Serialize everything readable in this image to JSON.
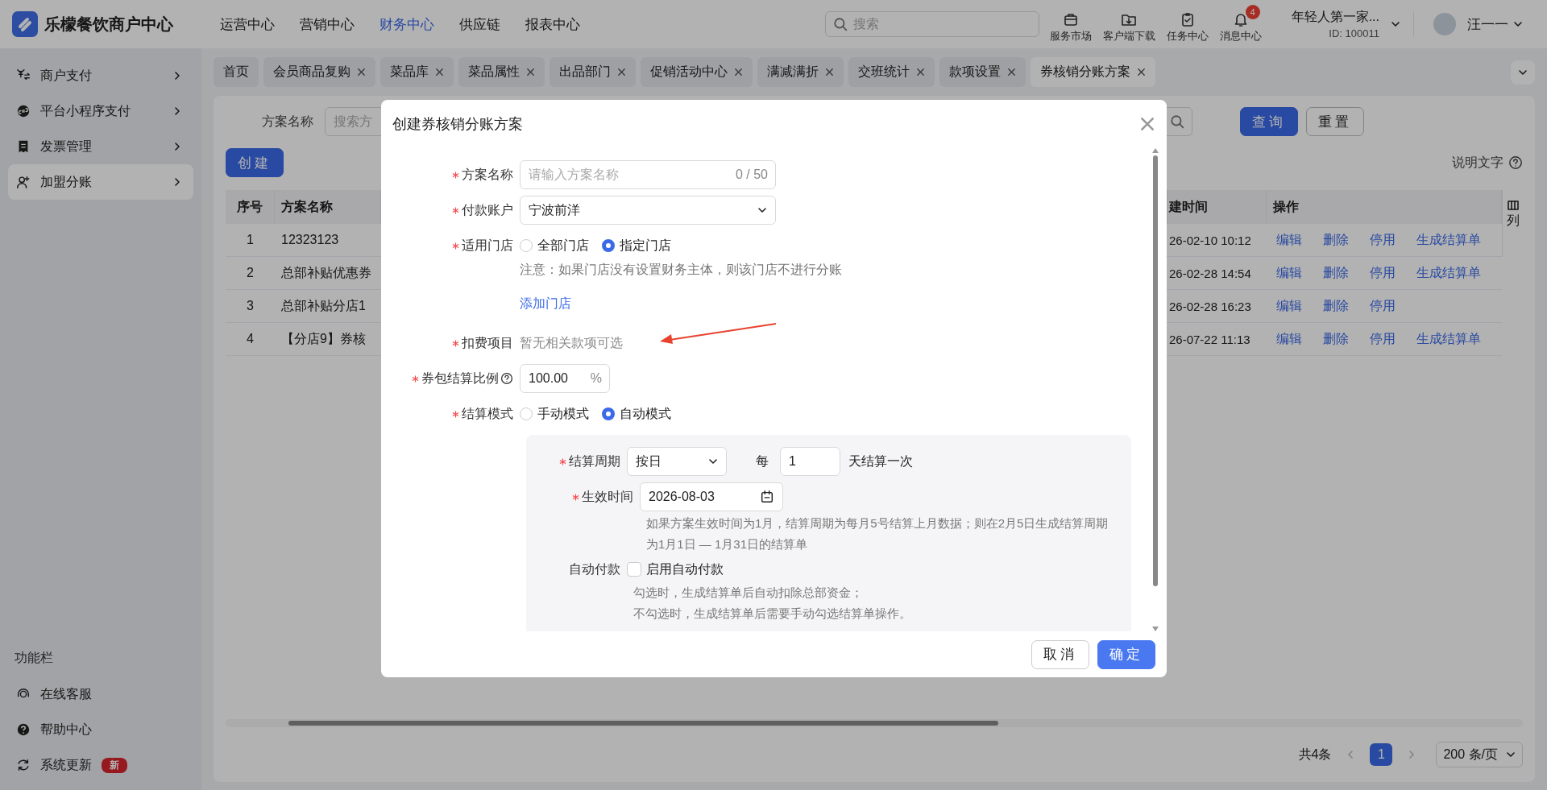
{
  "app": {
    "title": "乐檬餐饮商户中心"
  },
  "nav": [
    {
      "label": "运营中心",
      "selected": false
    },
    {
      "label": "营销中心",
      "selected": false
    },
    {
      "label": "财务中心",
      "selected": true
    },
    {
      "label": "供应链",
      "selected": false
    },
    {
      "label": "报表中心",
      "selected": false
    }
  ],
  "search": {
    "placeholder": "搜索"
  },
  "tools": [
    {
      "label": "服务市场"
    },
    {
      "label": "客户端下载"
    },
    {
      "label": "任务中心"
    },
    {
      "label": "消息中心",
      "badge": "4"
    }
  ],
  "account": {
    "store": "年轻人第一家...",
    "id": "ID: 100011"
  },
  "user": {
    "name": "汪一一"
  },
  "sidebar": {
    "items": [
      {
        "label": "商户支付",
        "selected": false
      },
      {
        "label": "平台小程序支付",
        "selected": false
      },
      {
        "label": "发票管理",
        "selected": false
      },
      {
        "label": "加盟分账",
        "selected": true
      }
    ],
    "section_title": "功能栏",
    "tools": [
      {
        "label": "在线客服"
      },
      {
        "label": "帮助中心"
      },
      {
        "label": "系统更新",
        "badge": "新"
      }
    ]
  },
  "tabs": [
    {
      "label": "首页",
      "closable": false,
      "selected": false
    },
    {
      "label": "会员商品复购",
      "closable": true,
      "selected": false
    },
    {
      "label": "菜品库",
      "closable": true,
      "selected": false
    },
    {
      "label": "菜品属性",
      "closable": true,
      "selected": false
    },
    {
      "label": "出品部门",
      "closable": true,
      "selected": false
    },
    {
      "label": "促销活动中心",
      "closable": true,
      "selected": false
    },
    {
      "label": "满减满折",
      "closable": true,
      "selected": false
    },
    {
      "label": "交班统计",
      "closable": true,
      "selected": false
    },
    {
      "label": "款项设置",
      "closable": true,
      "selected": false
    },
    {
      "label": "券核销分账方案",
      "closable": true,
      "selected": true
    }
  ],
  "filter": {
    "label": "方案名称",
    "placeholder": "搜索方",
    "buttons": [
      {
        "label": "查询",
        "kind": "primary"
      },
      {
        "label": "重置",
        "kind": "secondary"
      }
    ]
  },
  "create_button": "创建",
  "help_text": "说明文字",
  "table": {
    "columns": [
      "序号",
      "方案名称",
      "建时间",
      "操作"
    ],
    "column_settings": "列",
    "rows": [
      {
        "index": "1",
        "name": "12323123",
        "time": "26-02-10 10:12",
        "actions": [
          "编辑",
          "删除",
          "停用",
          "生成结算单"
        ]
      },
      {
        "index": "2",
        "name": "总部补贴优惠券",
        "time": "26-02-28 14:54",
        "actions": [
          "编辑",
          "删除",
          "停用",
          "生成结算单"
        ]
      },
      {
        "index": "3",
        "name": "总部补贴分店1",
        "time": "26-02-28 16:23",
        "actions": [
          "编辑",
          "删除",
          "停用"
        ]
      },
      {
        "index": "4",
        "name": "【分店9】券核",
        "time": "26-07-22 11:13",
        "actions": [
          "编辑",
          "删除",
          "停用",
          "生成结算单"
        ]
      }
    ]
  },
  "pagination": {
    "total": "共4条",
    "pages": [
      {
        "label": "1",
        "selected": true
      }
    ],
    "page_size": "200 条/页"
  },
  "dialog": {
    "title": "创建券核销分账方案",
    "fields": [
      {
        "kind": "text",
        "label": "方案名称",
        "required": true,
        "placeholder": "请输入方案名称",
        "counter": "0 / 50"
      },
      {
        "kind": "select",
        "label": "付款账户",
        "required": true,
        "value": "宁波前洋"
      },
      {
        "kind": "radio",
        "label": "适用门店",
        "required": true,
        "options": [
          {
            "label": "全部门店",
            "selected": false
          },
          {
            "label": "指定门店",
            "selected": true
          }
        ],
        "note": "注意：如果门店没有设置财务主体，则该门店不进行分账",
        "link": "添加门店"
      },
      {
        "kind": "static",
        "label": "扣费项目",
        "required": true,
        "value": "暂无相关款项可选"
      },
      {
        "kind": "percent",
        "label": "券包结算比例",
        "required": true,
        "help": true,
        "value": "100.00",
        "suffix": "%"
      },
      {
        "kind": "radio",
        "label": "结算模式",
        "required": true,
        "options": [
          {
            "label": "手动模式",
            "selected": false
          },
          {
            "label": "自动模式",
            "selected": true
          }
        ]
      }
    ],
    "panel": {
      "period": {
        "label": "结算周期",
        "required": true,
        "value": "按日",
        "prefix": "每",
        "count": "1",
        "suffix": "天结算一次"
      },
      "effective": {
        "label": "生效时间",
        "required": true,
        "value": "2026-08-03",
        "hint": "如果方案生效时间为1月，结算周期为每月5号结算上月数据；则在2月5日生成结算周期为1月1日 — 1月31日的结算单"
      },
      "auto_pay": {
        "label": "自动付款",
        "required": false,
        "option": "启用自动付款",
        "checked": false,
        "hints": [
          "勾选时，生成结算单后自动扣除总部资金；",
          "不勾选时，生成结算单后需要手动勾选结算单操作。"
        ]
      }
    },
    "buttons": [
      {
        "label": "取消",
        "kind": "secondary"
      },
      {
        "label": "确定",
        "kind": "primary"
      }
    ]
  }
}
